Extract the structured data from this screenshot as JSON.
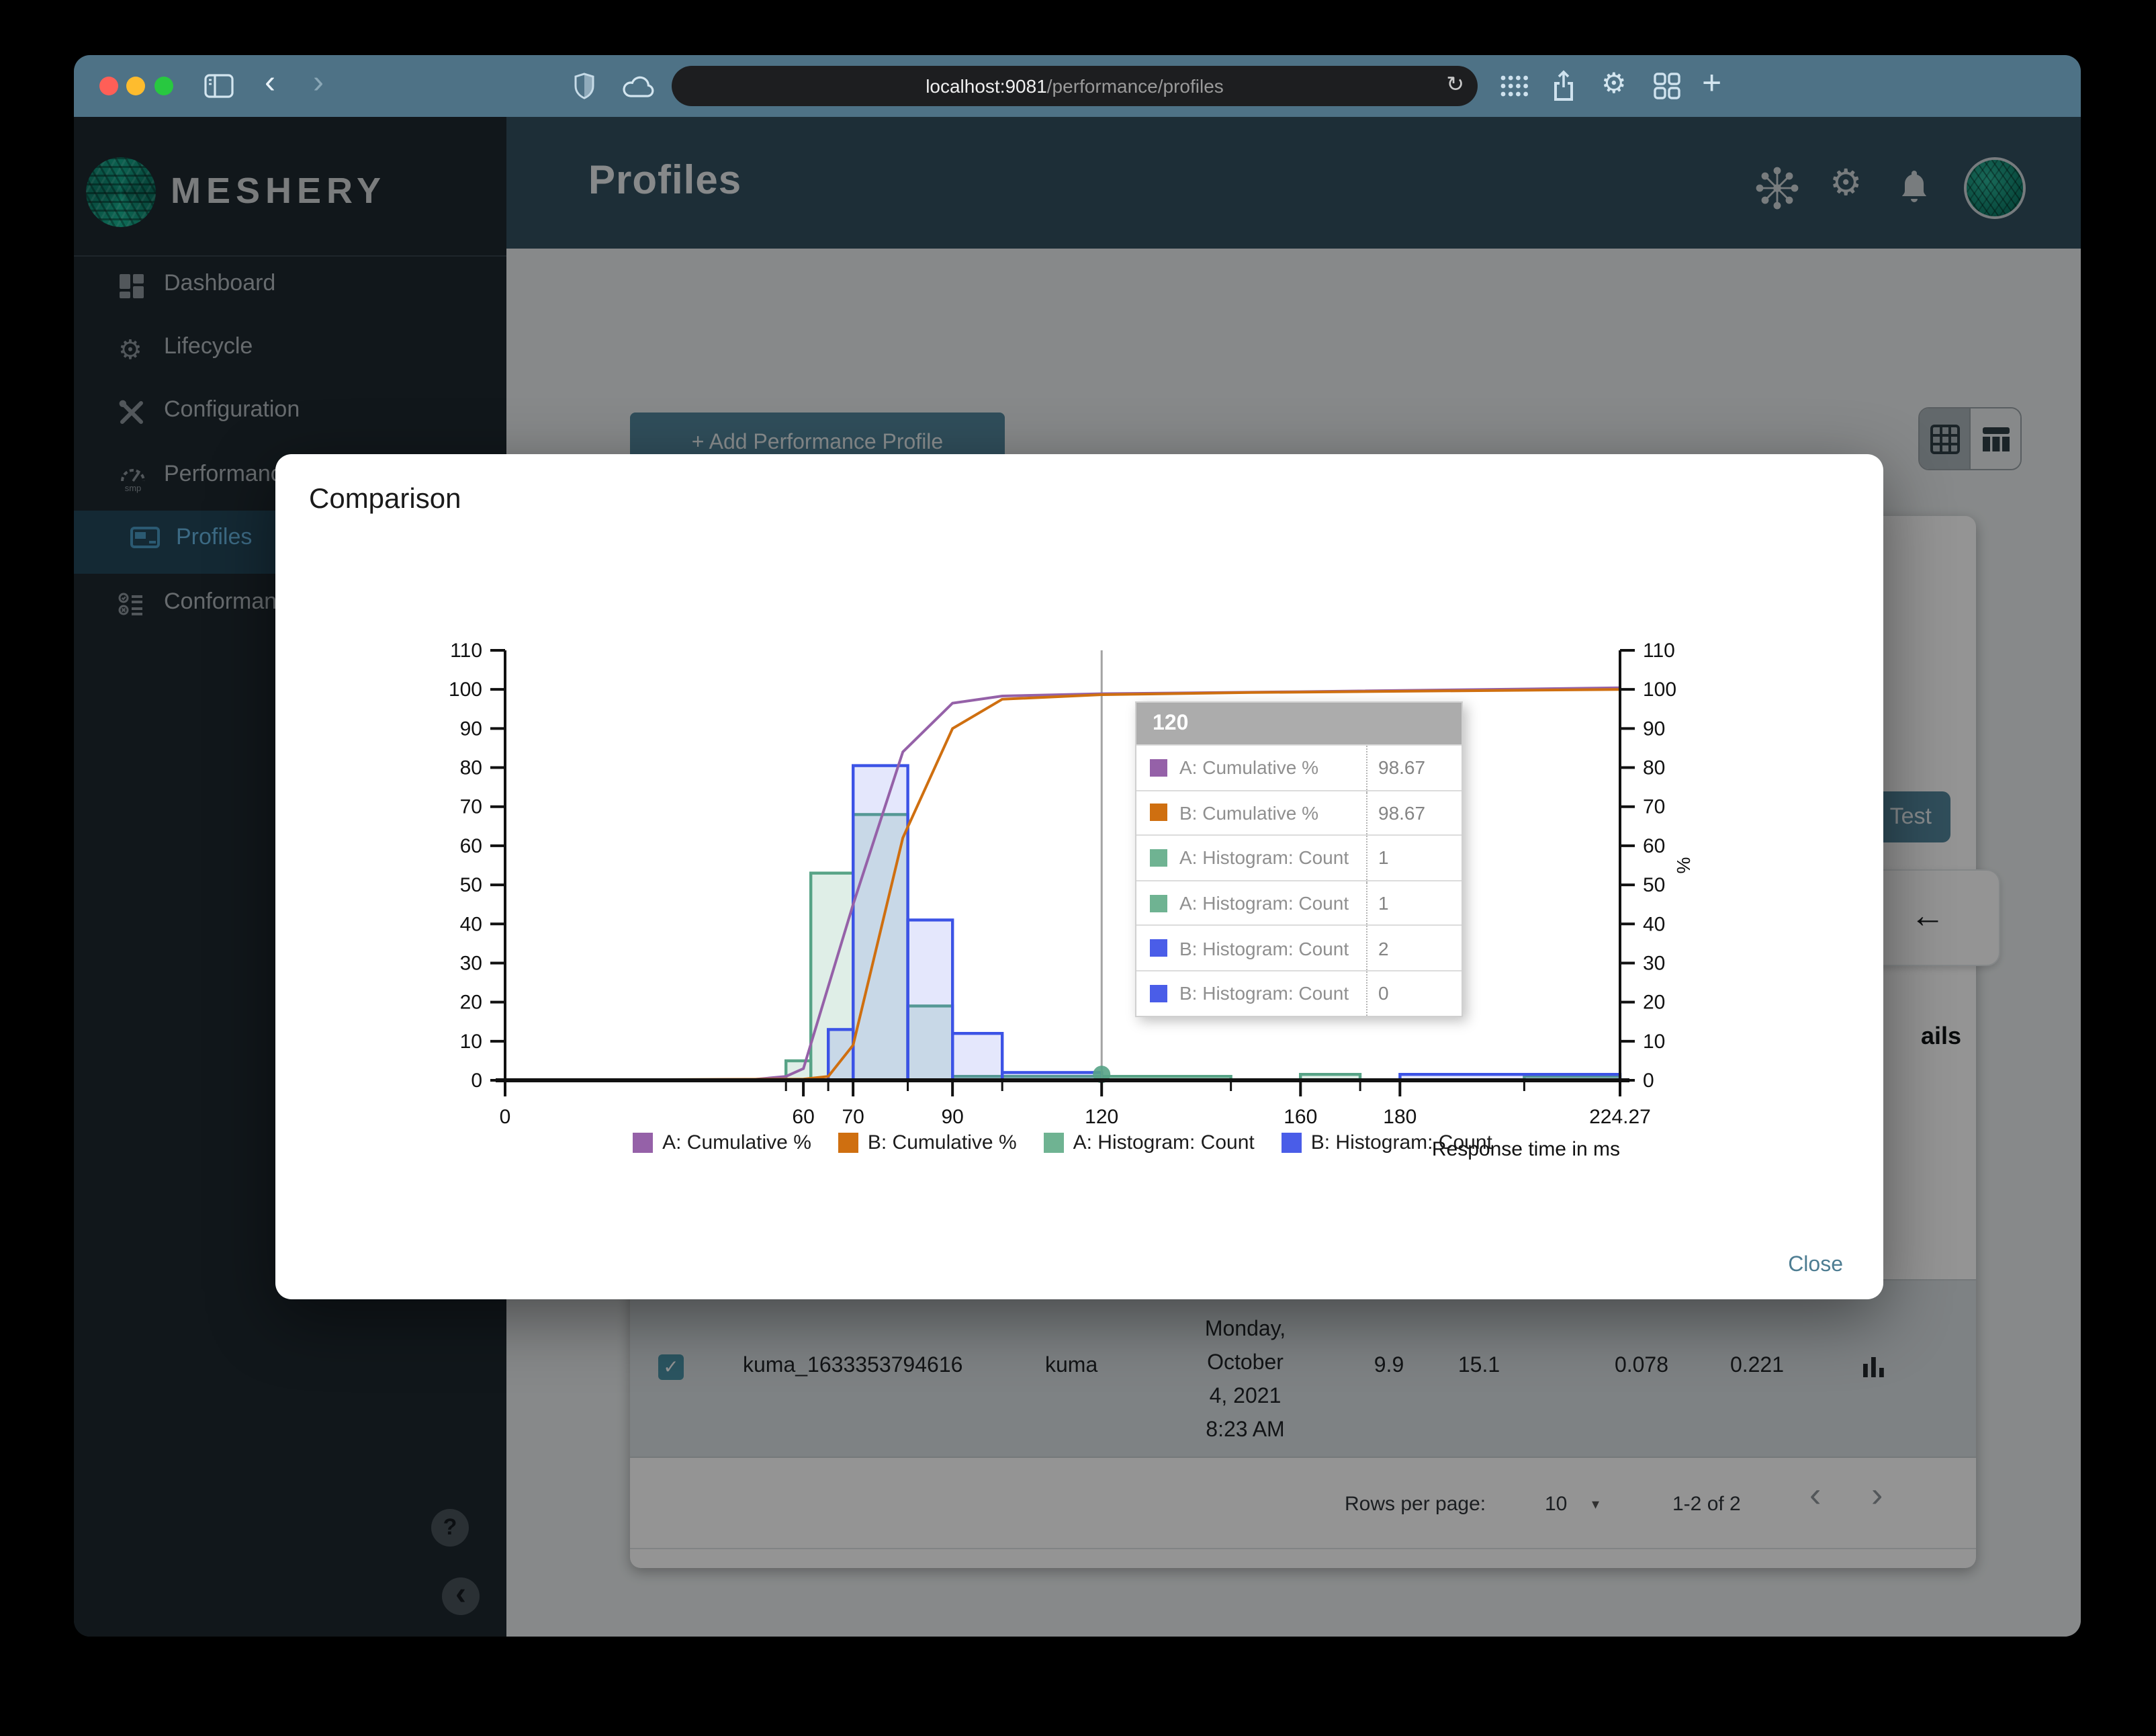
{
  "browser": {
    "url": {
      "host": "localhost:9081",
      "path": "/performance/profiles"
    }
  },
  "header": {
    "title": "Profiles"
  },
  "sidebar": {
    "brand": "MESHERY",
    "items": [
      {
        "label": "Dashboard"
      },
      {
        "label": "Lifecycle"
      },
      {
        "label": "Configuration"
      },
      {
        "label": "Performance"
      },
      {
        "label": "Profiles",
        "active": true
      },
      {
        "label": "Conformance"
      }
    ],
    "help_glyph": "?",
    "collapse_glyph": "‹"
  },
  "background": {
    "add_profile_button": "+ Add Performance Profile",
    "test_button": "Test",
    "details_text": "ails",
    "back_arrow": "←",
    "profile_row": {
      "name": "kuma_1633353794616",
      "mesh": "kuma",
      "date_lines": [
        "Monday,",
        "October",
        "4, 2021",
        "8:23 AM"
      ],
      "values": [
        "9.9",
        "15.1",
        "0.078",
        "0.221"
      ],
      "checkbox_checked": "✓"
    },
    "pagination": {
      "rows_per_page_label": "Rows per page:",
      "rows_per_page": "10",
      "range": "1-2 of 2",
      "prev": "‹",
      "next": "›"
    }
  },
  "modal": {
    "title": "Comparison",
    "close_label": "Close"
  },
  "chart_data": {
    "type": "histogram+cumulative-line",
    "xlabel": "Response time in ms",
    "right_ylabel": "%",
    "xlim": [
      0,
      224.27
    ],
    "ylim": [
      0,
      110
    ],
    "x_ticks": [
      {
        "v": 0,
        "label": "0"
      },
      {
        "v": 60,
        "label": "60"
      },
      {
        "v": 70,
        "label": "70"
      },
      {
        "v": 90,
        "label": "90"
      },
      {
        "v": 120,
        "label": "120"
      },
      {
        "v": 160,
        "label": "160"
      },
      {
        "v": 180,
        "label": "180"
      },
      {
        "v": 224.27,
        "label": "224.27"
      }
    ],
    "x_minor_ticks": [
      56.5,
      65,
      81,
      100,
      146,
      172,
      205
    ],
    "y_tick_step": 10,
    "series": [
      {
        "name": "A: Cumulative %",
        "kind": "line",
        "color": "#9561a8",
        "points": [
          [
            0,
            0
          ],
          [
            50,
            0.2
          ],
          [
            56.5,
            1
          ],
          [
            60,
            3
          ],
          [
            70,
            45
          ],
          [
            80,
            84
          ],
          [
            90,
            96.5
          ],
          [
            100,
            98.3
          ],
          [
            120,
            98.9
          ],
          [
            160,
            99.4
          ],
          [
            224.27,
            100.4
          ]
        ]
      },
      {
        "name": "B: Cumulative %",
        "kind": "line",
        "color": "#cf6f10",
        "points": [
          [
            0,
            0
          ],
          [
            60,
            0.3
          ],
          [
            65,
            1
          ],
          [
            70,
            9
          ],
          [
            80,
            62
          ],
          [
            90,
            90
          ],
          [
            100,
            97.5
          ],
          [
            120,
            98.67
          ],
          [
            150,
            99.2
          ],
          [
            224.27,
            100
          ]
        ]
      },
      {
        "name": "A: Histogram: Count",
        "kind": "histogram",
        "color": "#6fb392",
        "stroke": "#57a386",
        "fill_opacity": 0.22,
        "bins": [
          [
            56.5,
            61.5,
            5
          ],
          [
            61.5,
            70,
            53
          ],
          [
            70,
            81,
            68
          ],
          [
            81,
            90,
            19
          ],
          [
            90,
            120,
            1
          ],
          [
            120,
            146,
            1
          ],
          [
            160,
            172,
            1.5
          ],
          [
            205,
            224.27,
            1
          ]
        ]
      },
      {
        "name": "B: Histogram: Count",
        "kind": "histogram",
        "color": "#4a5de8",
        "stroke": "#3c53e6",
        "fill_opacity": 0.15,
        "bins": [
          [
            65,
            70,
            13
          ],
          [
            70,
            81,
            80.5
          ],
          [
            81,
            90,
            41
          ],
          [
            90,
            100,
            12
          ],
          [
            100,
            120,
            2
          ],
          [
            180,
            224.27,
            1.5
          ]
        ]
      }
    ],
    "crosshair_x": 120,
    "hover_marker": {
      "x": 120,
      "y": 1.5,
      "color": "#57a386"
    },
    "tooltip": {
      "header": "120",
      "rows": [
        {
          "color": "#9561a8",
          "label": "A: Cumulative %",
          "value": "98.67"
        },
        {
          "color": "#cf6f10",
          "label": "B: Cumulative %",
          "value": "98.67"
        },
        {
          "color": "#6fb392",
          "label": "A: Histogram: Count",
          "value": "1"
        },
        {
          "color": "#6fb392",
          "label": "A: Histogram: Count",
          "value": "1"
        },
        {
          "color": "#4a5de8",
          "label": "B: Histogram: Count",
          "value": "2"
        },
        {
          "color": "#4a5de8",
          "label": "B: Histogram: Count",
          "value": "0"
        }
      ]
    },
    "legend": [
      {
        "label": "A: Cumulative %",
        "color": "#9561a8"
      },
      {
        "label": "B: Cumulative %",
        "color": "#cf6f10"
      },
      {
        "label": "A: Histogram: Count",
        "color": "#6fb392"
      },
      {
        "label": "B: Histogram: Count",
        "color": "#4a5de8"
      }
    ]
  }
}
